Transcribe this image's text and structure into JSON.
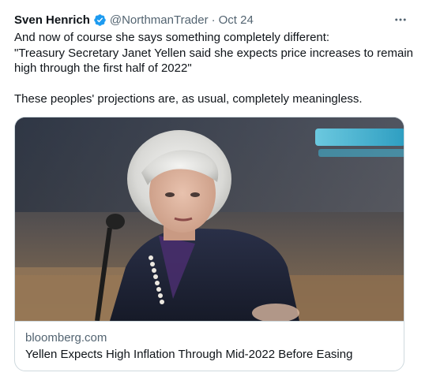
{
  "tweet": {
    "author_name": "Sven Henrich",
    "handle": "@NorthmanTrader",
    "separator": "·",
    "date": "Oct 24",
    "more_icon": "more-horizontal-icon",
    "verified_icon": "verified-badge-icon",
    "body_paragraphs": [
      "And now of course she says something completely different:\n\"Treasury Secretary Janet Yellen said she expects price increases to remain high through the first half of 2022\"",
      "These peoples' projections are, as usual, completely meaningless."
    ],
    "colors": {
      "verified": "#1d9bf0",
      "secondary_text": "#536471",
      "border": "#cfd9de"
    }
  },
  "card": {
    "domain": "bloomberg.com",
    "title": "Yellen Expects High Inflation Through Mid-2022 Before Easing"
  }
}
